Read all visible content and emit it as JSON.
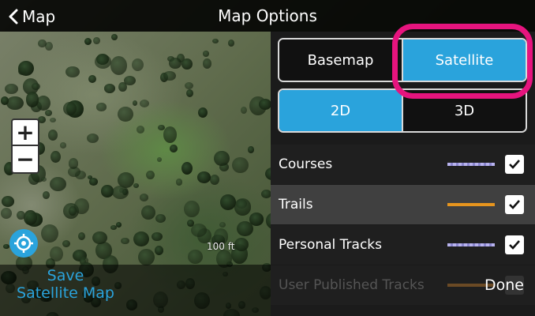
{
  "header": {
    "back_label": "Map",
    "title": "Map Options"
  },
  "map": {
    "zoom_in_label": "+",
    "zoom_out_label": "−",
    "scale_label": "100 ft",
    "save_label_line1": "Save",
    "save_label_line2": "Satellite Map"
  },
  "panel": {
    "map_type": {
      "options": [
        "Basemap",
        "Satellite"
      ],
      "selected": "Satellite"
    },
    "view_mode": {
      "options": [
        "2D",
        "3D"
      ],
      "selected": "2D"
    },
    "layers": [
      {
        "label": "Courses",
        "checked": true,
        "swatch": "purple"
      },
      {
        "label": "Trails",
        "checked": true,
        "swatch": "orange"
      },
      {
        "label": "Personal Tracks",
        "checked": true,
        "swatch": "purple"
      },
      {
        "label": "User Published Tracks",
        "checked": false,
        "swatch": "brown"
      }
    ],
    "done_label": "Done"
  },
  "colors": {
    "accent": "#2aa3dc",
    "highlight": "#e6147e",
    "panel_bg": "#1b1b1b"
  }
}
